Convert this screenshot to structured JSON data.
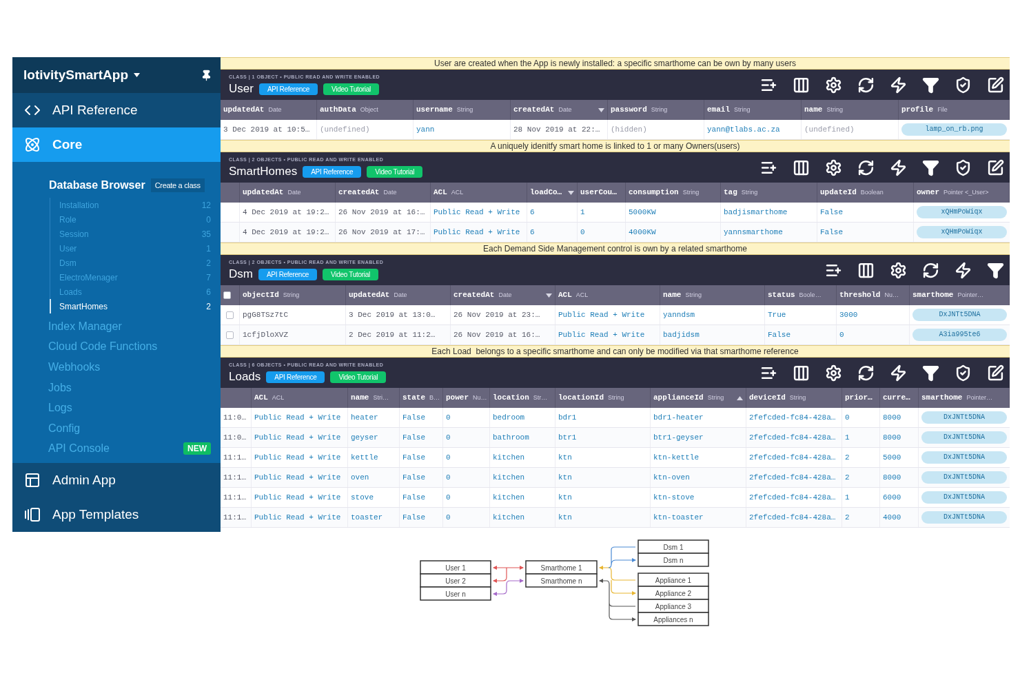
{
  "sidebar": {
    "app_name": "IotivitySmartApp",
    "nav": [
      {
        "label": "API Reference",
        "kind": "code",
        "selected": false
      },
      {
        "label": "Core",
        "kind": "core",
        "selected": true
      },
      {
        "label": "Admin App",
        "kind": "admin",
        "selected": false
      },
      {
        "label": "App Templates",
        "kind": "templates",
        "selected": false
      }
    ],
    "core_panel": {
      "title": "Database Browser",
      "action": "Create a class",
      "classes": [
        {
          "name": "Installation",
          "count": "12",
          "selected": false
        },
        {
          "name": "Role",
          "count": "0",
          "selected": false
        },
        {
          "name": "Session",
          "count": "35",
          "selected": false
        },
        {
          "name": "User",
          "count": "1",
          "selected": false
        },
        {
          "name": "Dsm",
          "count": "2",
          "selected": false
        },
        {
          "name": "ElectroMenager",
          "count": "7",
          "selected": false
        },
        {
          "name": "Loads",
          "count": "6",
          "selected": false
        },
        {
          "name": "SmartHomes",
          "count": "2",
          "selected": true
        }
      ],
      "links": [
        {
          "label": "Index Manager"
        },
        {
          "label": "Cloud Code Functions"
        },
        {
          "label": "Webhooks"
        },
        {
          "label": "Jobs"
        },
        {
          "label": "Logs"
        },
        {
          "label": "Config"
        },
        {
          "label": "API Console",
          "badge": "NEW"
        }
      ]
    }
  },
  "sections": [
    {
      "banner": "User are created when the App is newly installed: a specific smarthome can be own by many users",
      "info": "CLASS | 1 OBJECT • PUBLIC READ AND WRITE ENABLED",
      "name": "User",
      "buttons": [
        {
          "label": "API Reference",
          "kind": "api"
        },
        {
          "label": "Video Tutorial",
          "kind": "video"
        }
      ],
      "toolbar": [
        {
          "kind": "add-row"
        },
        {
          "kind": "add-column"
        },
        {
          "kind": "settings"
        },
        {
          "kind": "refresh"
        },
        {
          "kind": "cloud-code"
        },
        {
          "kind": "filter"
        },
        {
          "kind": "security"
        },
        {
          "kind": "edit"
        }
      ],
      "columns": [
        {
          "kind": "plain",
          "name": "updatedAt",
          "type": "Date"
        },
        {
          "kind": "muted",
          "name": "authData",
          "type": "Object"
        },
        {
          "kind": "link",
          "name": "username",
          "type": "String"
        },
        {
          "kind": "plain",
          "name": "createdAt",
          "type": "Date",
          "descending": true
        },
        {
          "kind": "muted",
          "name": "password",
          "type": "String"
        },
        {
          "kind": "link",
          "name": "email",
          "type": "String"
        },
        {
          "kind": "muted",
          "name": "name",
          "type": "String"
        },
        {
          "kind": "pointer",
          "name": "profile",
          "type": "File"
        }
      ],
      "rows": [
        {
          "cells": [
            "3 Dec 2019 at 10:5…",
            "(undefined)",
            "yann",
            "28 Nov 2019 at 22:…",
            "(hidden)",
            "yann@tlabs.ac.za",
            "(undefined)",
            "lamp_on_rb.png"
          ]
        }
      ]
    },
    {
      "banner": "A uniquely idenitfy smart home is linked to 1 or many Owners(users)",
      "info": "CLASS | 2 OBJECTS • PUBLIC READ AND WRITE ENABLED",
      "name": "SmartHomes",
      "buttons": [
        {
          "label": "API Reference",
          "kind": "api"
        },
        {
          "label": "Video Tutorial",
          "kind": "video"
        }
      ],
      "toolbar": [
        {
          "kind": "add-row"
        },
        {
          "kind": "add-column"
        },
        {
          "kind": "settings"
        },
        {
          "kind": "refresh"
        },
        {
          "kind": "cloud-code"
        },
        {
          "kind": "filter"
        },
        {
          "kind": "security"
        },
        {
          "kind": "edit"
        }
      ],
      "columns": [
        {
          "kind": "blank"
        },
        {
          "kind": "plain",
          "name": "updatedAt",
          "type": "Date"
        },
        {
          "kind": "plain",
          "name": "createdAt",
          "type": "Date"
        },
        {
          "kind": "link",
          "name": "ACL",
          "type": "ACL"
        },
        {
          "kind": "link",
          "name": "loadCo…",
          "descending": true
        },
        {
          "kind": "link",
          "name": "userCou…"
        },
        {
          "kind": "link",
          "name": "consumption",
          "type": "String"
        },
        {
          "kind": "link",
          "name": "tag",
          "type": "String"
        },
        {
          "kind": "link",
          "name": "updateId",
          "type": "Boolean"
        },
        {
          "kind": "pointer",
          "name": "owner",
          "type": "Pointer <_User>"
        }
      ],
      "rows": [
        {
          "cells": [
            "",
            "4 Dec 2019 at 19:2…",
            "26 Nov 2019 at 16:…",
            "Public Read + Write",
            "6",
            "1",
            "5000KW",
            "badjismarthome",
            "False",
            "xQHmPoWiqx"
          ]
        },
        {
          "cells": [
            "",
            "4 Dec 2019 at 19:2…",
            "26 Nov 2019 at 17:…",
            "Public Read + Write",
            "6",
            "0",
            "4000KW",
            "yannsmarthome",
            "False",
            "xQHmPoWiqx"
          ]
        }
      ]
    },
    {
      "banner": "Each Demand Side Management control is own by a related smarthome",
      "info": "CLASS | 2 OBJECTS • PUBLIC READ AND WRITE ENABLED",
      "name": "Dsm",
      "buttons": [
        {
          "label": "API Reference",
          "kind": "api"
        },
        {
          "label": "Video Tutorial",
          "kind": "video"
        }
      ],
      "toolbar": [
        {
          "kind": "add-row"
        },
        {
          "kind": "add-column"
        },
        {
          "kind": "settings"
        },
        {
          "kind": "refresh"
        },
        {
          "kind": "cloud-code"
        },
        {
          "kind": "filter"
        }
      ],
      "columns": [
        {
          "kind": "checkbox",
          "checked": false
        },
        {
          "kind": "plain",
          "name": "objectId",
          "type": "String"
        },
        {
          "kind": "plain",
          "name": "updatedAt",
          "type": "Date"
        },
        {
          "kind": "plain",
          "name": "createdAt",
          "type": "Date",
          "descending": true
        },
        {
          "kind": "link",
          "name": "ACL",
          "type": "ACL"
        },
        {
          "kind": "link",
          "name": "name",
          "type": "String"
        },
        {
          "kind": "link",
          "name": "status",
          "type": "Boole…"
        },
        {
          "kind": "link",
          "name": "threshold",
          "type": "Nu…"
        },
        {
          "kind": "pointer",
          "name": "smarthome",
          "type": "Pointer…"
        }
      ],
      "rows": [
        {
          "checked": false,
          "cells": [
            "",
            "pgG8TSz7tC",
            "3 Dec 2019 at 13:0…",
            "26 Nov 2019 at 23:…",
            "Public Read + Write",
            "yanndsm",
            "True",
            "3000",
            "DxJNTt5DNA"
          ]
        },
        {
          "checked": false,
          "cells": [
            "",
            "1cfjDloXVZ",
            "2 Dec 2019 at 11:2…",
            "26 Nov 2019 at 16:…",
            "Public Read + Write",
            "badjidsm",
            "False",
            "0",
            "A3ia995te6"
          ]
        }
      ]
    },
    {
      "banner": "Each Load  belongs to a specific smarthome and can only be modified via that smarthome reference",
      "info": "CLASS | 6 OBJECTS • PUBLIC READ AND WRITE ENABLED",
      "name": "Loads",
      "buttons": [
        {
          "label": "API Reference",
          "kind": "api"
        },
        {
          "label": "Video Tutorial",
          "kind": "video"
        }
      ],
      "toolbar": [
        {
          "kind": "add-row"
        },
        {
          "kind": "add-column"
        },
        {
          "kind": "settings"
        },
        {
          "kind": "refresh"
        },
        {
          "kind": "cloud-code"
        },
        {
          "kind": "filter"
        },
        {
          "kind": "security"
        },
        {
          "kind": "edit"
        }
      ],
      "columns": [
        {
          "kind": "plain"
        },
        {
          "kind": "link",
          "name": "ACL",
          "type": "ACL"
        },
        {
          "kind": "link",
          "name": "name",
          "type": "Stri…"
        },
        {
          "kind": "link",
          "name": "state",
          "type": "B…"
        },
        {
          "kind": "link",
          "name": "power",
          "type": "Nu…"
        },
        {
          "kind": "link",
          "name": "location",
          "type": "Str…"
        },
        {
          "kind": "link",
          "name": "locationId",
          "type": "String"
        },
        {
          "kind": "link",
          "name": "applianceId",
          "type": "String",
          "descending": false
        },
        {
          "kind": "link",
          "name": "deviceId",
          "type": "String"
        },
        {
          "kind": "link",
          "name": "prior…"
        },
        {
          "kind": "link",
          "name": "curre…"
        },
        {
          "kind": "pointer",
          "name": "smarthome",
          "type": "Pointer…"
        }
      ],
      "rows": [
        {
          "cells": [
            "11:0…",
            "Public Read + Write",
            "heater",
            "False",
            "0",
            "bedroom",
            "bdr1",
            "bdr1-heater",
            "2fefcded-fc84-428a…",
            "0",
            "8000",
            "DxJNTt5DNA"
          ]
        },
        {
          "cells": [
            "11:0…",
            "Public Read + Write",
            "geyser",
            "False",
            "0",
            "bathroom",
            "btr1",
            "btr1-geyser",
            "2fefcded-fc84-428a…",
            "1",
            "8000",
            "DxJNTt5DNA"
          ]
        },
        {
          "cells": [
            "11:1…",
            "Public Read + Write",
            "kettle",
            "False",
            "0",
            "kitchen",
            "ktn",
            "ktn-kettle",
            "2fefcded-fc84-428a…",
            "2",
            "5000",
            "DxJNTt5DNA"
          ]
        },
        {
          "cells": [
            "11:1…",
            "Public Read + Write",
            "oven",
            "False",
            "0",
            "kitchen",
            "ktn",
            "ktn-oven",
            "2fefcded-fc84-428a…",
            "2",
            "8000",
            "DxJNTt5DNA"
          ]
        },
        {
          "cells": [
            "11:1…",
            "Public Read + Write",
            "stove",
            "False",
            "0",
            "kitchen",
            "ktn",
            "ktn-stove",
            "2fefcded-fc84-428a…",
            "1",
            "6000",
            "DxJNTt5DNA"
          ]
        },
        {
          "cells": [
            "11:1…",
            "Public Read + Write",
            "toaster",
            "False",
            "0",
            "kitchen",
            "ktn",
            "ktn-toaster",
            "2fefcded-fc84-428a…",
            "2",
            "4000",
            "DxJNTt5DNA"
          ]
        }
      ]
    }
  ],
  "diagram": {
    "users": [
      "User 1",
      "User 2",
      "User n"
    ],
    "smarthomes": [
      "Smarthome 1",
      "Smarthome n"
    ],
    "dsm": [
      "Dsm 1",
      "Dsm n"
    ],
    "appliances": [
      "Appliance 1",
      "Appliance 2",
      "Appliance 3",
      "Appliances n"
    ]
  }
}
